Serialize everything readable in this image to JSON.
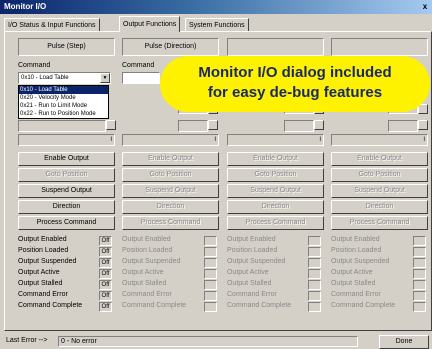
{
  "window": {
    "title": "Monitor I/O",
    "close": "x"
  },
  "tabs": [
    {
      "label": "I/O Status & Input Functions"
    },
    {
      "label": "Output Functions"
    },
    {
      "label": "System Functions"
    }
  ],
  "columns": [
    {
      "title": "Pulse (Step)"
    },
    {
      "title": "Pulse (Direction)"
    },
    {
      "title": ""
    },
    {
      "title": ""
    }
  ],
  "command": {
    "label": "Command",
    "label2": "Command",
    "selected": "0x10 - Load Table",
    "options": [
      "0x10 - Load Table",
      "0x20 - Velocity Mode",
      "0x21 - Run to Limit Mode",
      "0x22 - Run to Position Mode"
    ]
  },
  "field_values": [
    "I",
    "I",
    "I",
    "I"
  ],
  "buttons": [
    "Enable Output",
    "Goto Position",
    "Suspend Output",
    "Direction",
    "Process Command"
  ],
  "status_labels": [
    "Output Enabled",
    "Position Loaded",
    "Output Suspended",
    "Output Active",
    "Output Stalled",
    "Command Error",
    "Command Complete"
  ],
  "indicator_text": "Off",
  "overlay": {
    "line1": "Monitor I/O dialog included",
    "line2": "for easy de-bug features"
  },
  "statusbar": {
    "label": "Last Error -->",
    "message": "0 - No error",
    "done": "Done"
  },
  "colors": {
    "title_bar": "#0a246a",
    "overlay_bg": "#fff200",
    "overlay_text": "#1a2a66"
  }
}
